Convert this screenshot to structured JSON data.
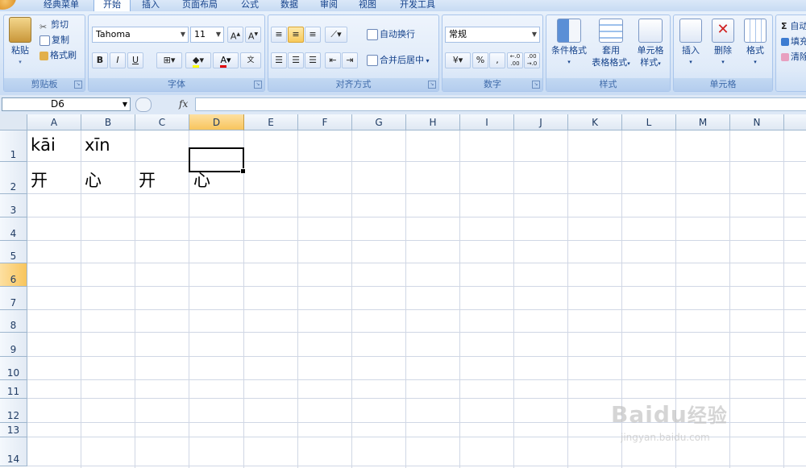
{
  "tabs": [
    "经典菜单",
    "开始",
    "插入",
    "页面布局",
    "公式",
    "数据",
    "审阅",
    "视图",
    "开发工具"
  ],
  "clipboard": {
    "paste": "粘贴",
    "cut": "剪切",
    "copy": "复制",
    "format_painter": "格式刷",
    "title": "剪贴板"
  },
  "font": {
    "name": "Tahoma",
    "size": "11",
    "bold": "B",
    "italic": "I",
    "underline": "U",
    "title": "字体",
    "phonetic": "wén"
  },
  "alignment": {
    "wrap": "自动换行",
    "merge": "合并后居中",
    "title": "对齐方式"
  },
  "number": {
    "format": "常规",
    "percent": "%",
    "comma": ",",
    "inc_decimal": "+.0 .00",
    "dec_decimal": ".00 ÷.0",
    "title": "数字"
  },
  "styles": {
    "conditional": "条件格式",
    "table_fmt_1": "套用",
    "table_fmt_2": "表格格式",
    "cell_styles_1": "单元格",
    "cell_styles_2": "样式",
    "title": "样式"
  },
  "cells": {
    "insert": "插入",
    "delete": "删除",
    "format": "格式",
    "title": "单元格"
  },
  "editing": {
    "autosum": "自动",
    "fill": "填充",
    "clear": "清除"
  },
  "formula_bar": {
    "name_box": "D6",
    "fx": "fx",
    "content": ""
  },
  "columns": [
    "A",
    "B",
    "C",
    "D",
    "E",
    "F",
    "G",
    "H",
    "I",
    "J",
    "K",
    "L",
    "M",
    "N"
  ],
  "rows": [
    "1",
    "2",
    "3",
    "4",
    "5",
    "6",
    "7",
    "8",
    "9",
    "10",
    "11",
    "12",
    "13",
    "14"
  ],
  "selected_cell": {
    "column": "D",
    "row": "6"
  },
  "cell_values": {
    "A1": "kāi",
    "B1": "xīn",
    "A2": "开",
    "B2": "心",
    "C2": "开",
    "D2": "心"
  },
  "watermark": {
    "brand": "Baidu",
    "brand_cn": "经验",
    "url": "jingyan.baidu.com"
  }
}
